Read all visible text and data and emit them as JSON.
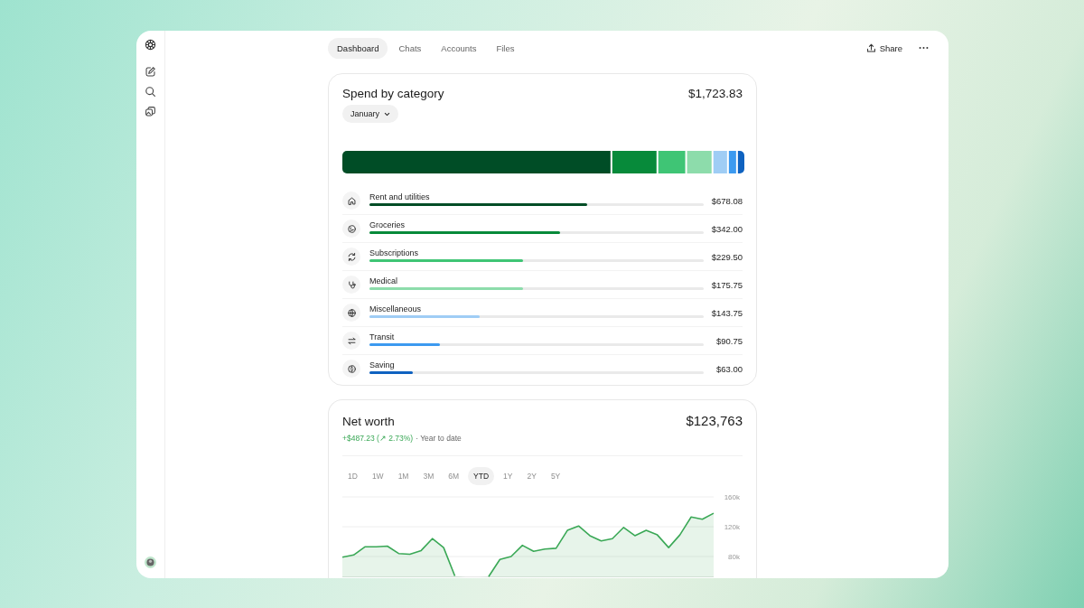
{
  "tabs": [
    {
      "label": "Dashboard",
      "selected": true
    },
    {
      "label": "Chats",
      "selected": false
    },
    {
      "label": "Accounts",
      "selected": false
    },
    {
      "label": "Files",
      "selected": false
    }
  ],
  "share": "Share",
  "spend": {
    "title": "Spend by category",
    "total": "$1,723.83",
    "month": "January",
    "categories": [
      {
        "kind": "home",
        "label": "Rent and utilities",
        "amount": "$678.08",
        "level": 0.65,
        "color": "#004d26"
      },
      {
        "kind": "groceries",
        "label": "Groceries",
        "amount": "$342.00",
        "level": 0.57,
        "color": "#078a3a"
      },
      {
        "kind": "refresh",
        "label": "Subscriptions",
        "amount": "$229.50",
        "level": 0.46,
        "color": "#3fc575"
      },
      {
        "kind": "medical",
        "label": "Medical",
        "amount": "$175.75",
        "level": 0.46,
        "color": "#8ddcab"
      },
      {
        "kind": "globe",
        "label": "Miscellaneous",
        "amount": "$143.75",
        "level": 0.33,
        "color": "#9fcdf5"
      },
      {
        "kind": "transfer",
        "label": "Transit",
        "amount": "$90.75",
        "level": 0.21,
        "color": "#3c9af0"
      },
      {
        "kind": "dollar",
        "label": "Saving",
        "amount": "$63.00",
        "level": 0.13,
        "color": "#0f62c0"
      }
    ]
  },
  "net_worth": {
    "title": "Net worth",
    "value": "$123,763",
    "change": "+$487.23 (↗ 2.73%)",
    "period": "· Year to date",
    "ranges": [
      {
        "label": "1D",
        "selected": false
      },
      {
        "label": "1W",
        "selected": false
      },
      {
        "label": "1M",
        "selected": false
      },
      {
        "label": "3M",
        "selected": false
      },
      {
        "label": "6M",
        "selected": false
      },
      {
        "label": "YTD",
        "selected": true
      },
      {
        "label": "1Y",
        "selected": false
      },
      {
        "label": "2Y",
        "selected": false
      },
      {
        "label": "5Y",
        "selected": false
      }
    ],
    "chart_data": {
      "type": "area",
      "ylim": [
        52000,
        160000
      ],
      "yticks": [
        {
          "value": 160000,
          "label": "160k"
        },
        {
          "value": 120000,
          "label": "120k"
        },
        {
          "value": 80000,
          "label": "80k"
        }
      ],
      "series": [
        {
          "color": "#3aa856",
          "values": [
            79000,
            82000,
            93000,
            93000,
            94000,
            84000,
            83000,
            88000,
            104000,
            92000,
            54000,
            null,
            null,
            53000,
            76000,
            80000,
            95000,
            87000,
            90000,
            91000,
            115000,
            121000,
            108000,
            101000,
            104000,
            119000,
            108000,
            115000,
            109000,
            92000,
            109000,
            133000,
            130000,
            138000
          ]
        }
      ]
    }
  }
}
